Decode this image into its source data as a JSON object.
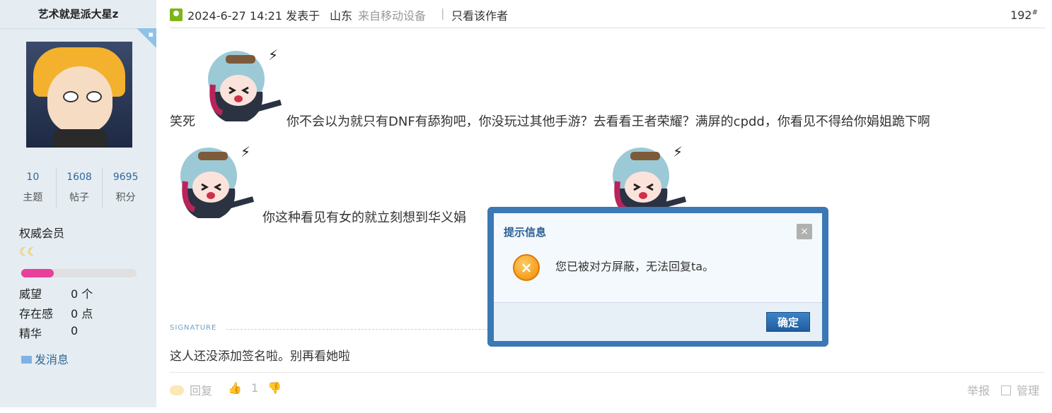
{
  "author": {
    "name": "艺术就是派大星z",
    "stats": [
      {
        "value": "10",
        "label": "主题"
      },
      {
        "value": "1608",
        "label": "帖子"
      },
      {
        "value": "9695",
        "label": "积分"
      }
    ],
    "group": "权威会员",
    "level_icons": "☾☾",
    "level_progress": 0.28,
    "attributes": [
      {
        "label": "威望",
        "value": "0 个"
      },
      {
        "label": "存在感",
        "value": "0 点"
      },
      {
        "label": "精华",
        "value": "0"
      }
    ],
    "send_message": "发消息"
  },
  "post": {
    "date": "2024-6-27 14:21 发表于",
    "location": "山东",
    "device": "来自移动设备",
    "separator": "|",
    "only_author": "只看该作者",
    "floor": "192",
    "floor_suffix": "#",
    "line1_prefix": "笑死",
    "line1_text": "你不会以为就只有DNF有舔狗吧，你没玩过其他手游？去看看王者荣耀？满屏的cpdd，你看见不得给你娟姐跪下啊",
    "line2_text": "你这种看见有女的就立刻想到华义娟"
  },
  "signature": {
    "label": "SIGNATURE",
    "text": "这人还没添加签名啦。别再看她啦"
  },
  "footer": {
    "reply": "回复",
    "like_count": "1",
    "report": "举报",
    "manage": "管理"
  },
  "modal": {
    "title": "提示信息",
    "close": "×",
    "icon": "×",
    "message": "您已被对方屏蔽，无法回复ta。",
    "ok": "确定"
  },
  "colors": {
    "sidebar_bg": "#e5edf2",
    "link": "#336699",
    "modal_border": "#3b78b4",
    "progress": "#e9409a"
  }
}
